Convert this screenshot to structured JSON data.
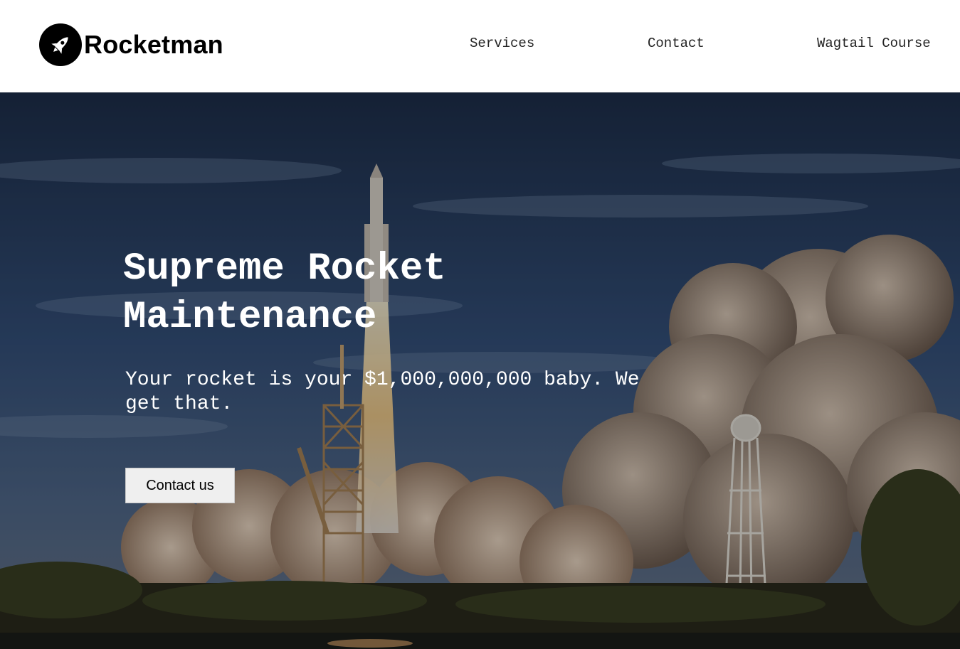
{
  "header": {
    "brand_name": "Rocketman",
    "logo_icon": "rocket-icon",
    "nav": [
      {
        "label": "Services"
      },
      {
        "label": "Contact"
      },
      {
        "label": "Wagtail Course"
      }
    ]
  },
  "hero": {
    "title": "Supreme Rocket Maintenance",
    "subtitle": "Your rocket is your $1,000,000,000 baby. We get that.",
    "cta_label": "Contact us",
    "background": "rocket-launch-photo"
  },
  "colors": {
    "header_bg": "#ffffff",
    "logo_bg": "#000000",
    "hero_text": "#ffffff",
    "button_bg": "#efefef"
  }
}
